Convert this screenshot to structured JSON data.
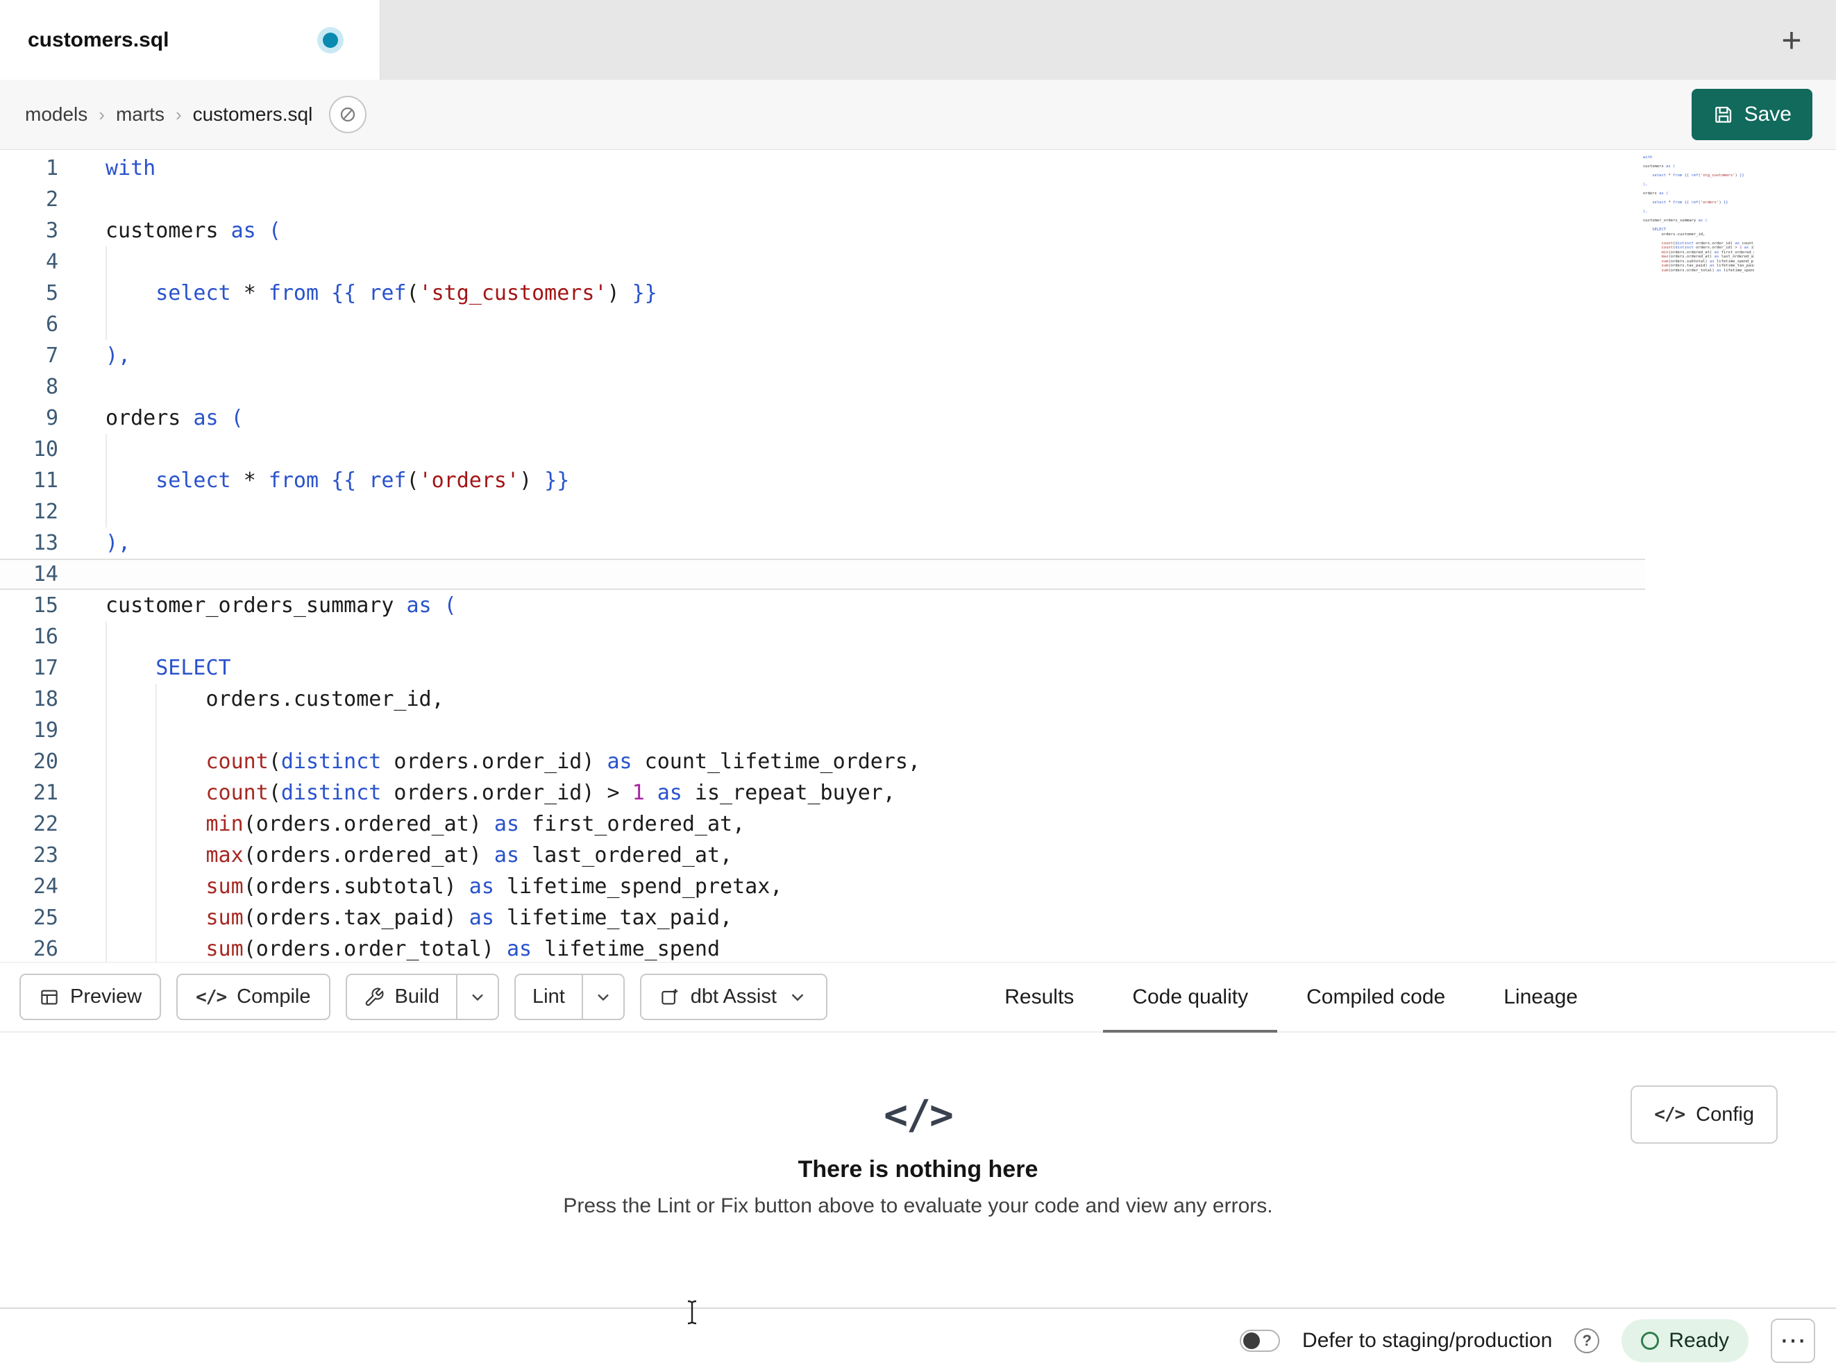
{
  "colors": {
    "c_keyword": "#2952cc",
    "c_function": "#a72822",
    "c_string": "#a31515",
    "c_number": "#a626a4",
    "c_accent": "#116a5c",
    "c_unsaved_dot": "#0a8ab0",
    "c_ready_bg": "#e4f3e8",
    "c_ready_icon": "#2f7d4f"
  },
  "icons": {
    "code_glyph": "</>",
    "new_tab_glyph": "+",
    "help_glyph": "?",
    "more_glyph": "⋯"
  },
  "tabbar": {
    "active_tab": {
      "label": "customers.sql",
      "unsaved": true
    }
  },
  "breadcrumb": {
    "items": [
      "models",
      "marts",
      "customers.sql"
    ]
  },
  "header": {
    "save_label": "Save"
  },
  "editor": {
    "active_line": 14,
    "lines": [
      {
        "n": 1,
        "guides": [],
        "tokens": [
          [
            "with",
            "kw"
          ]
        ]
      },
      {
        "n": 2,
        "guides": [],
        "tokens": []
      },
      {
        "n": 3,
        "guides": [],
        "tokens": [
          [
            "customers ",
            "pl"
          ],
          [
            "as",
            "kw"
          ],
          [
            " ",
            "pl"
          ],
          [
            "(",
            "kw"
          ]
        ]
      },
      {
        "n": 4,
        "guides": [
          0
        ],
        "tokens": []
      },
      {
        "n": 5,
        "guides": [
          0
        ],
        "tokens": [
          [
            "    ",
            "pl"
          ],
          [
            "select",
            "kw"
          ],
          [
            " ",
            "pl"
          ],
          [
            "*",
            "op"
          ],
          [
            " ",
            "pl"
          ],
          [
            "from",
            "kw"
          ],
          [
            " ",
            "pl"
          ],
          [
            "{{ ",
            "kw"
          ],
          [
            "ref",
            "kw"
          ],
          [
            "(",
            "pl"
          ],
          [
            "'stg_customers'",
            "str"
          ],
          [
            ")",
            "pl"
          ],
          [
            " ",
            "pl"
          ],
          [
            "}}",
            "kw"
          ]
        ]
      },
      {
        "n": 6,
        "guides": [
          0
        ],
        "tokens": []
      },
      {
        "n": 7,
        "guides": [],
        "tokens": [
          [
            "),",
            "kw"
          ]
        ]
      },
      {
        "n": 8,
        "guides": [],
        "tokens": []
      },
      {
        "n": 9,
        "guides": [],
        "tokens": [
          [
            "orders ",
            "pl"
          ],
          [
            "as",
            "kw"
          ],
          [
            " ",
            "pl"
          ],
          [
            "(",
            "kw"
          ]
        ]
      },
      {
        "n": 10,
        "guides": [
          0
        ],
        "tokens": []
      },
      {
        "n": 11,
        "guides": [
          0
        ],
        "tokens": [
          [
            "    ",
            "pl"
          ],
          [
            "select",
            "kw"
          ],
          [
            " ",
            "pl"
          ],
          [
            "*",
            "op"
          ],
          [
            " ",
            "pl"
          ],
          [
            "from",
            "kw"
          ],
          [
            " ",
            "pl"
          ],
          [
            "{{ ",
            "kw"
          ],
          [
            "ref",
            "kw"
          ],
          [
            "(",
            "pl"
          ],
          [
            "'orders'",
            "str"
          ],
          [
            ")",
            "pl"
          ],
          [
            " ",
            "pl"
          ],
          [
            "}}",
            "kw"
          ]
        ]
      },
      {
        "n": 12,
        "guides": [
          0
        ],
        "tokens": []
      },
      {
        "n": 13,
        "guides": [],
        "tokens": [
          [
            "),",
            "kw"
          ]
        ]
      },
      {
        "n": 14,
        "guides": [],
        "tokens": []
      },
      {
        "n": 15,
        "guides": [],
        "tokens": [
          [
            "customer_orders_summary ",
            "pl"
          ],
          [
            "as",
            "kw"
          ],
          [
            " ",
            "pl"
          ],
          [
            "(",
            "kw"
          ]
        ]
      },
      {
        "n": 16,
        "guides": [
          0
        ],
        "tokens": []
      },
      {
        "n": 17,
        "guides": [
          0
        ],
        "tokens": [
          [
            "    ",
            "pl"
          ],
          [
            "SELECT",
            "kw"
          ]
        ]
      },
      {
        "n": 18,
        "guides": [
          0,
          4
        ],
        "tokens": [
          [
            "        ",
            "pl"
          ],
          [
            "orders.customer_id,",
            "pl"
          ]
        ]
      },
      {
        "n": 19,
        "guides": [
          0,
          4
        ],
        "tokens": []
      },
      {
        "n": 20,
        "guides": [
          0,
          4
        ],
        "tokens": [
          [
            "        ",
            "pl"
          ],
          [
            "count",
            "fn"
          ],
          [
            "(",
            "pl"
          ],
          [
            "distinct",
            "kw"
          ],
          [
            " orders.order_id",
            "pl"
          ],
          [
            ")",
            "pl"
          ],
          [
            " ",
            "pl"
          ],
          [
            "as",
            "kw"
          ],
          [
            " count_lifetime_orders,",
            "pl"
          ]
        ]
      },
      {
        "n": 21,
        "guides": [
          0,
          4
        ],
        "tokens": [
          [
            "        ",
            "pl"
          ],
          [
            "count",
            "fn"
          ],
          [
            "(",
            "pl"
          ],
          [
            "distinct",
            "kw"
          ],
          [
            " orders.order_id",
            "pl"
          ],
          [
            ")",
            "pl"
          ],
          [
            " > ",
            "op"
          ],
          [
            "1",
            "num"
          ],
          [
            " ",
            "pl"
          ],
          [
            "as",
            "kw"
          ],
          [
            " is_repeat_buyer,",
            "pl"
          ]
        ]
      },
      {
        "n": 22,
        "guides": [
          0,
          4
        ],
        "tokens": [
          [
            "        ",
            "pl"
          ],
          [
            "min",
            "fn"
          ],
          [
            "(orders.ordered_at)",
            "pl"
          ],
          [
            " ",
            "pl"
          ],
          [
            "as",
            "kw"
          ],
          [
            " first_ordered_at,",
            "pl"
          ]
        ]
      },
      {
        "n": 23,
        "guides": [
          0,
          4
        ],
        "tokens": [
          [
            "        ",
            "pl"
          ],
          [
            "max",
            "fn"
          ],
          [
            "(orders.ordered_at)",
            "pl"
          ],
          [
            " ",
            "pl"
          ],
          [
            "as",
            "kw"
          ],
          [
            " last_ordered_at,",
            "pl"
          ]
        ]
      },
      {
        "n": 24,
        "guides": [
          0,
          4
        ],
        "tokens": [
          [
            "        ",
            "pl"
          ],
          [
            "sum",
            "fn"
          ],
          [
            "(orders.subtotal)",
            "pl"
          ],
          [
            " ",
            "pl"
          ],
          [
            "as",
            "kw"
          ],
          [
            " lifetime_spend_pretax,",
            "pl"
          ]
        ]
      },
      {
        "n": 25,
        "guides": [
          0,
          4
        ],
        "tokens": [
          [
            "        ",
            "pl"
          ],
          [
            "sum",
            "fn"
          ],
          [
            "(orders.tax_paid)",
            "pl"
          ],
          [
            " ",
            "pl"
          ],
          [
            "as",
            "kw"
          ],
          [
            " lifetime_tax_paid,",
            "pl"
          ]
        ]
      },
      {
        "n": 26,
        "guides": [
          0,
          4
        ],
        "tokens": [
          [
            "        ",
            "pl"
          ],
          [
            "sum",
            "fn"
          ],
          [
            "(orders.order_total)",
            "pl"
          ],
          [
            " ",
            "pl"
          ],
          [
            "as",
            "kw"
          ],
          [
            " lifetime_spend",
            "pl"
          ]
        ]
      }
    ]
  },
  "toolbar": {
    "preview_label": "Preview",
    "compile_label": "Compile",
    "build_label": "Build",
    "lint_label": "Lint",
    "assist_label": "dbt Assist"
  },
  "panel_tabs": {
    "items": [
      {
        "label": "Results",
        "active": false
      },
      {
        "label": "Code quality",
        "active": true
      },
      {
        "label": "Compiled code",
        "active": false
      },
      {
        "label": "Lineage",
        "active": false
      }
    ]
  },
  "results_panel": {
    "config_label": "Config",
    "empty_title": "There is nothing here",
    "empty_description": "Press the Lint or Fix button above to evaluate your code and view any errors."
  },
  "statusbar": {
    "defer_label": "Defer to staging/production",
    "ready_label": "Ready"
  }
}
